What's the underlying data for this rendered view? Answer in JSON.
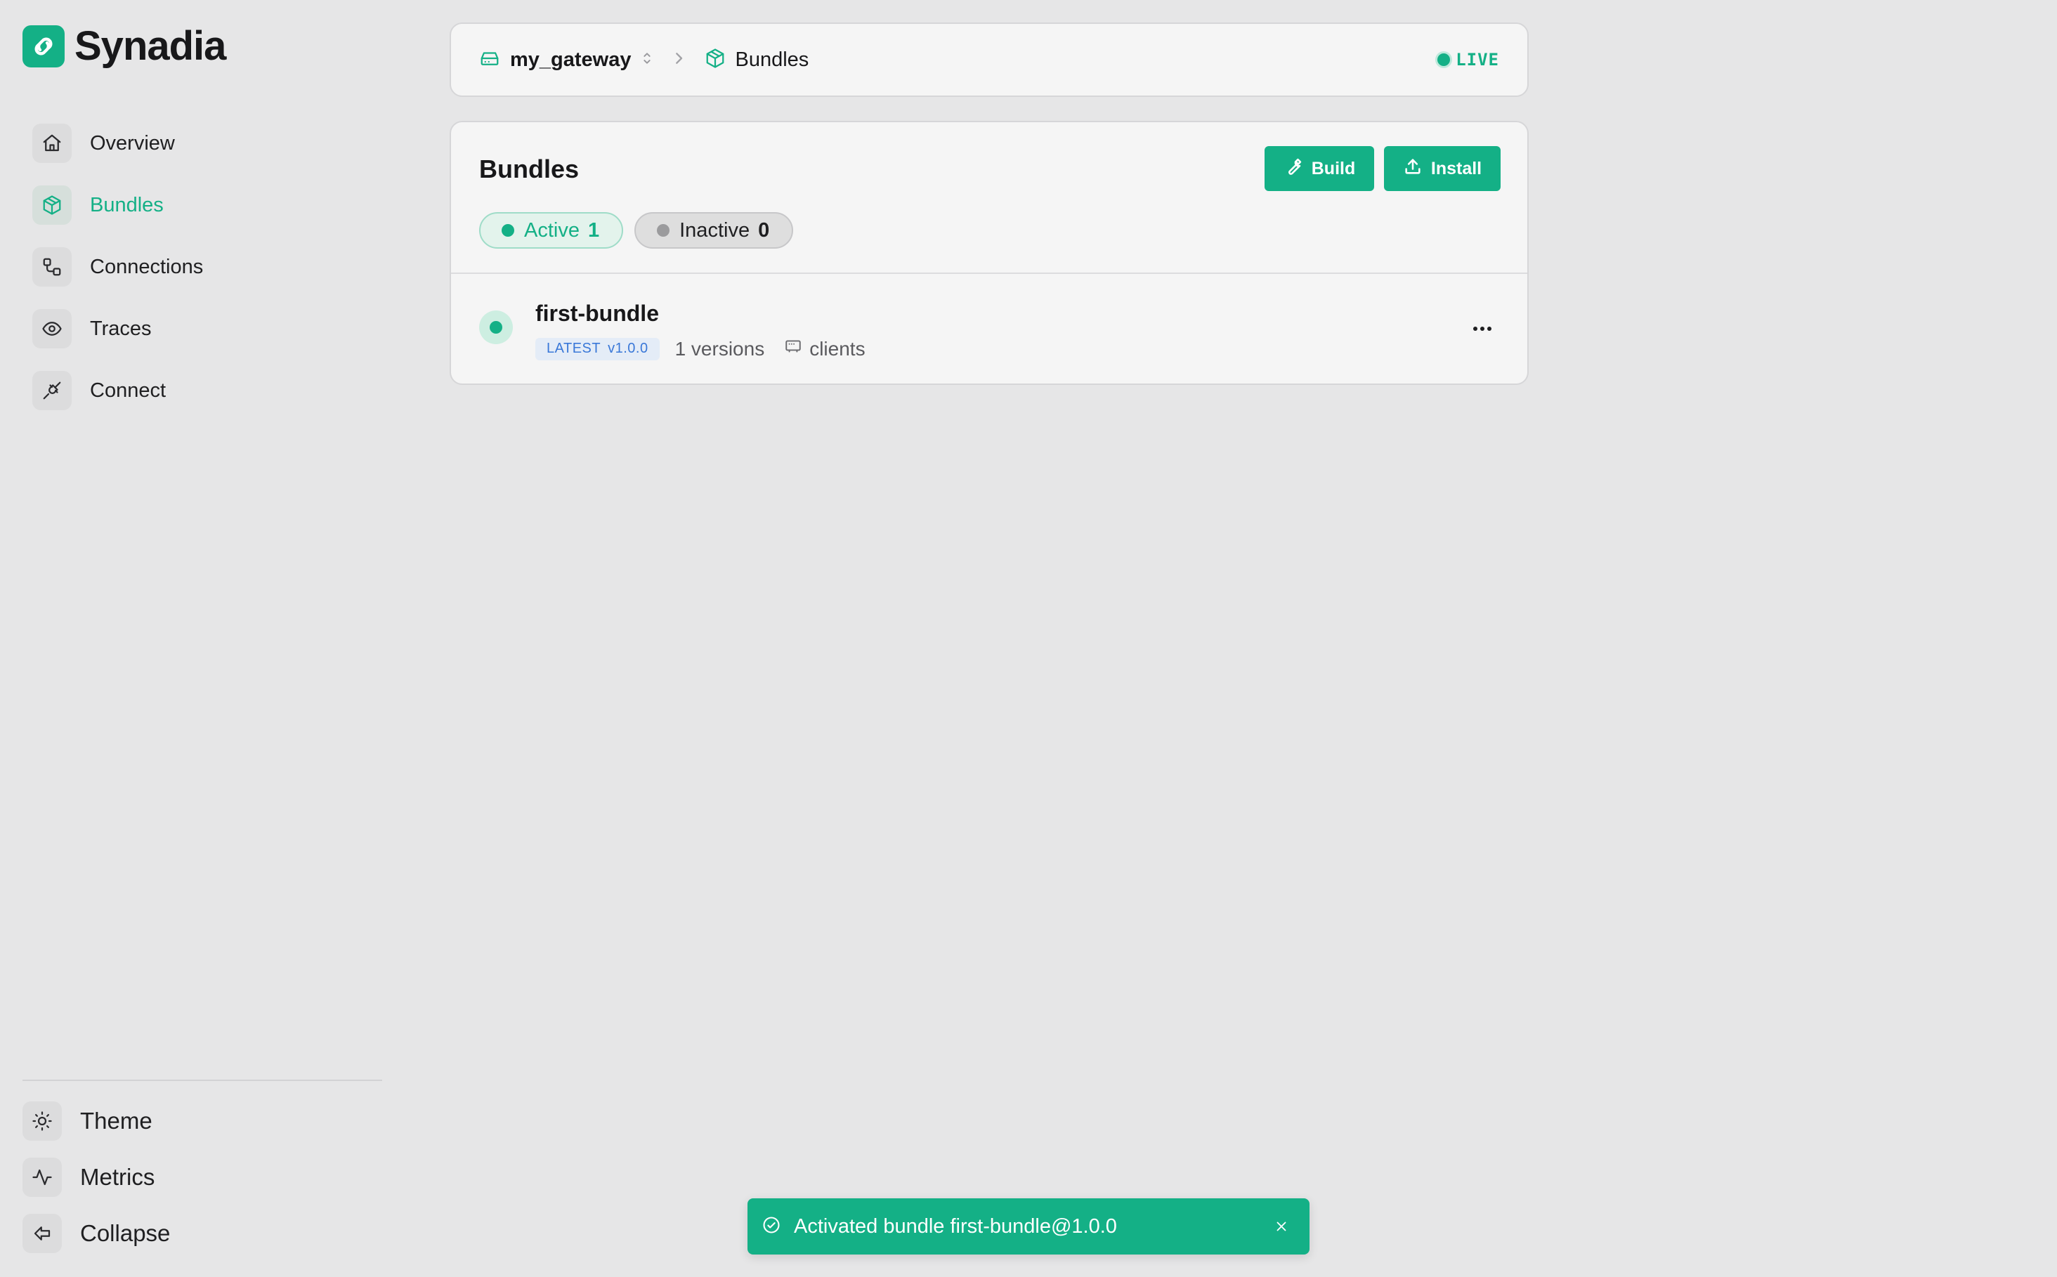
{
  "brand": {
    "name": "Synadia"
  },
  "sidebar": {
    "items": [
      {
        "label": "Overview",
        "icon": "home-icon",
        "active": false
      },
      {
        "label": "Bundles",
        "icon": "package-icon",
        "active": true
      },
      {
        "label": "Connections",
        "icon": "connections-icon",
        "active": false
      },
      {
        "label": "Traces",
        "icon": "eye-icon",
        "active": false
      },
      {
        "label": "Connect",
        "icon": "plug-icon",
        "active": false
      }
    ],
    "footer": [
      {
        "label": "Theme",
        "icon": "sun-icon"
      },
      {
        "label": "Metrics",
        "icon": "activity-icon"
      },
      {
        "label": "Collapse",
        "icon": "collapse-icon"
      }
    ]
  },
  "header": {
    "gateway": "my_gateway",
    "section": "Bundles",
    "status": "LIVE"
  },
  "bundles": {
    "title": "Bundles",
    "build_label": "Build",
    "install_label": "Install",
    "filters": {
      "active_label": "Active",
      "active_count": "1",
      "inactive_label": "Inactive",
      "inactive_count": "0"
    },
    "items": [
      {
        "name": "first-bundle",
        "badge_tag": "LATEST",
        "badge_version": "v1.0.0",
        "versions": "1 versions",
        "clients": "clients"
      }
    ]
  },
  "toast": {
    "message": "Activated bundle first-bundle@1.0.0"
  },
  "colors": {
    "accent": "#14b086",
    "background": "#e6e6e7",
    "card": "#f5f5f5",
    "badge_text": "#3a78d8"
  }
}
